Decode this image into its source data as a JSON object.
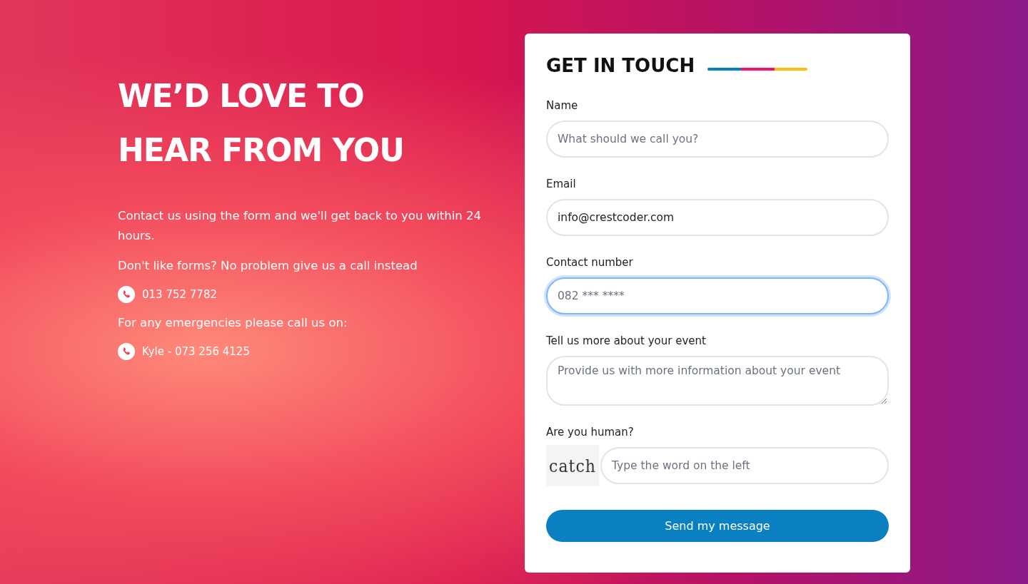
{
  "hero": {
    "title_lines": [
      "WE’D LOVE TO",
      "HEAR FROM YOU"
    ],
    "paragraphs": [
      {
        "kind": "text",
        "text": "Contact us using the form and we'll get back to you within 24 hours."
      },
      {
        "kind": "text",
        "text": "Don't like forms? No problem give us a call instead"
      },
      {
        "kind": "phone",
        "text": "013 752 7782"
      },
      {
        "kind": "text",
        "text": "For any emergencies please call us on:"
      },
      {
        "kind": "phone",
        "text": "Kyle - 073 256 4125"
      }
    ]
  },
  "form": {
    "title": "GET IN TOUCH",
    "fields": [
      {
        "kind": "text",
        "label": "Name",
        "placeholder": "What should we call you?",
        "focused": false
      },
      {
        "kind": "text",
        "label": "Email",
        "value": "info@crestcoder.com",
        "focused": false
      },
      {
        "kind": "text",
        "label": "Contact number",
        "placeholder": "082 *** ****",
        "focused": true
      },
      {
        "kind": "textarea",
        "label": "Tell us more about your event",
        "placeholder": "Provide us with more information about your event",
        "focused": false
      },
      {
        "kind": "captcha",
        "label": "Are you human?",
        "captcha": "catch",
        "placeholder": "Type the word on the left",
        "focused": false
      }
    ],
    "submit": "Send my message"
  }
}
